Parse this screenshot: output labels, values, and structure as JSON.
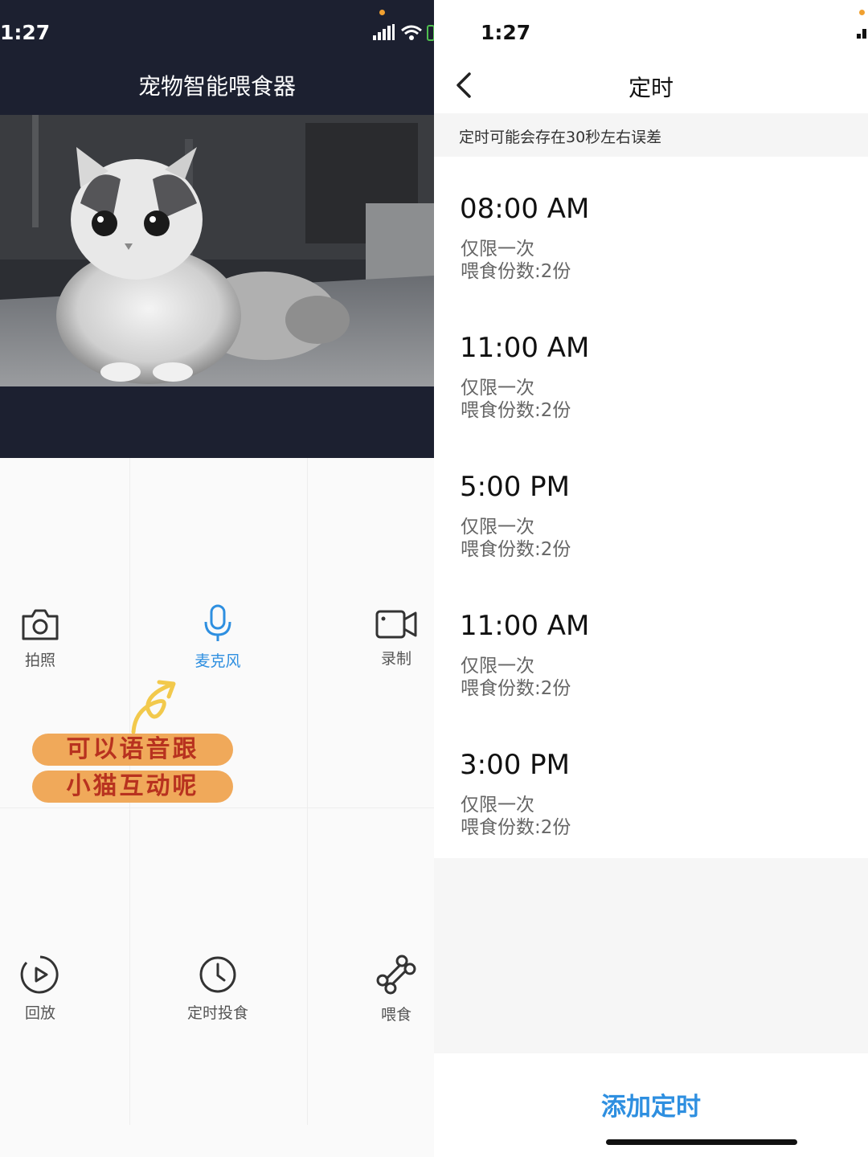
{
  "left_screen": {
    "status_time": "1:27",
    "title": "宠物智能喂食器",
    "controls": [
      {
        "label": "拍照",
        "icon": "camera-icon"
      },
      {
        "label": "麦克风",
        "icon": "microphone-icon",
        "active": true
      },
      {
        "label": "录制",
        "icon": "video-record-icon"
      },
      {
        "label": "回放",
        "icon": "playback-icon"
      },
      {
        "label": "定时投食",
        "icon": "clock-icon"
      },
      {
        "label": "喂食",
        "icon": "bone-icon"
      }
    ],
    "annotation": {
      "line1": "可以语音跟",
      "line2": "小猫互动呢"
    }
  },
  "right_screen": {
    "status_time": "1:27",
    "title": "定时",
    "notice": "定时可能会存在30秒左右误差",
    "timers": [
      {
        "time": "08:00 AM",
        "repeat": "仅限一次",
        "portion": "喂食份数:2份"
      },
      {
        "time": "11:00 AM",
        "repeat": "仅限一次",
        "portion": "喂食份数:2份"
      },
      {
        "time": "5:00 PM",
        "repeat": "仅限一次",
        "portion": "喂食份数:2份"
      },
      {
        "time": "11:00 AM",
        "repeat": "仅限一次",
        "portion": "喂食份数:2份"
      },
      {
        "time": "3:00 PM",
        "repeat": "仅限一次",
        "portion": "喂食份数:2份"
      }
    ],
    "add_button": "添加定时"
  },
  "colors": {
    "header_bg": "#1c2030",
    "accent_blue": "#2e8fe0",
    "annotation_bubble": "#f0a95a",
    "annotation_text": "#b8321f"
  }
}
